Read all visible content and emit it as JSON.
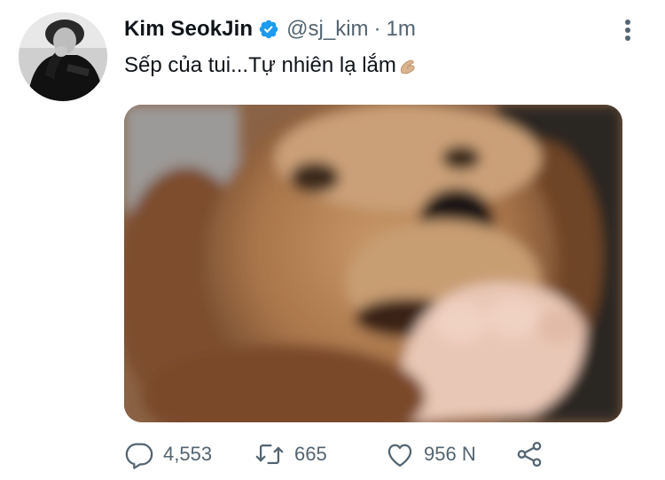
{
  "tweet": {
    "display_name": "Kim SeokJin",
    "handle": "@sj_kim",
    "separator": "·",
    "time": "1m",
    "text": "Sếp của tui...Tự nhiên lạ lắm",
    "verified": true
  },
  "actions": {
    "reply_count": "4,553",
    "retweet_count": "665",
    "like_count": "956 N"
  },
  "icons": {
    "verified": "verified-badge-icon",
    "more": "more-vertical-icon",
    "emoji": "pinching-hand-emoji",
    "reply": "reply-icon",
    "retweet": "retweet-icon",
    "like": "heart-icon",
    "share": "share-icon"
  },
  "colors": {
    "verified_blue": "#1d9bf0",
    "secondary_text": "#536471",
    "primary_text": "#0f1419"
  }
}
